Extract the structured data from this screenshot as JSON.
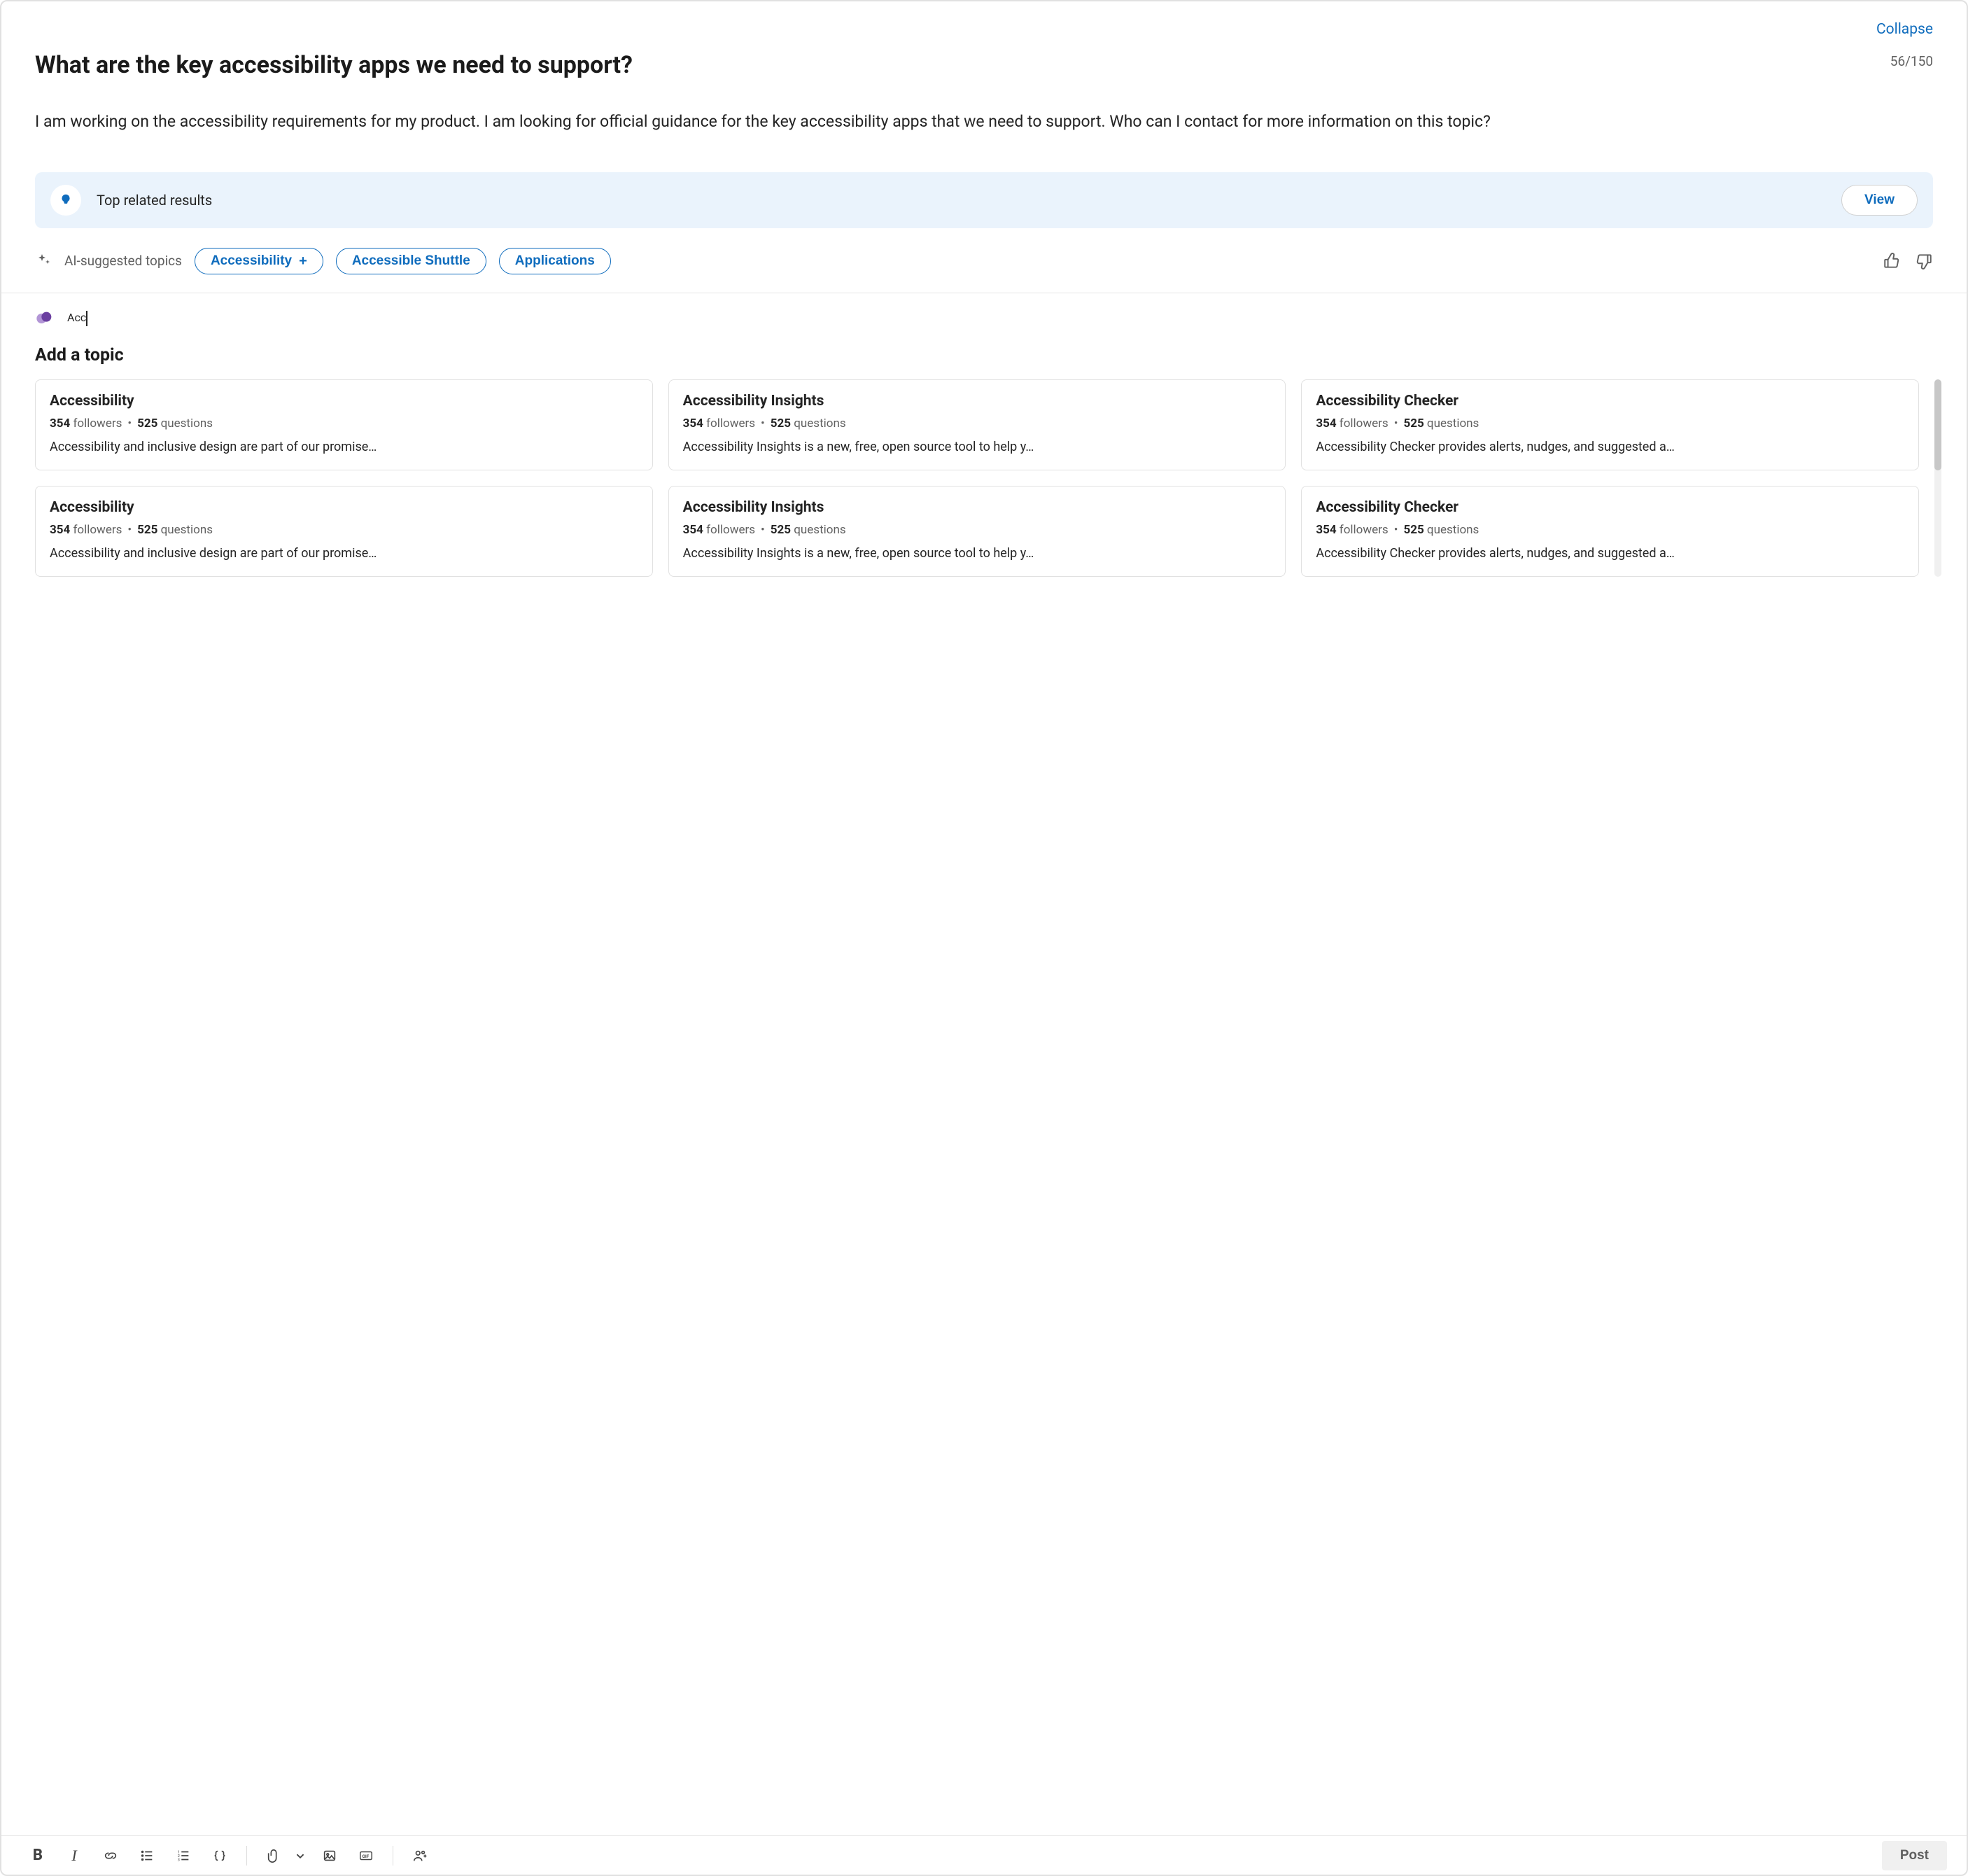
{
  "header": {
    "collapse_label": "Collapse",
    "title": "What are the key accessibility apps we need to support?",
    "char_count": "56/150"
  },
  "body_text": "I am working on the accessibility requirements for my product. I am looking for official guidance for the key accessibility apps that we need to support. Who can I contact for more information on this topic?",
  "related": {
    "label": "Top related results",
    "view_label": "View"
  },
  "ai": {
    "label": "AI-suggested topics",
    "chips": [
      {
        "label": "Accessibility",
        "has_plus": true
      },
      {
        "label": "Accessible Shuttle",
        "has_plus": false
      },
      {
        "label": "Applications",
        "has_plus": false
      }
    ]
  },
  "topic_input": {
    "value": "Acc"
  },
  "add_topic": {
    "heading": "Add a topic",
    "cards": [
      {
        "title": "Accessibility",
        "followers_n": "354",
        "followers_l": "followers",
        "questions_n": "525",
        "questions_l": "questions",
        "desc": "Accessibility and inclusive design are part of our promise…"
      },
      {
        "title": "Accessibility Insights",
        "followers_n": "354",
        "followers_l": "followers",
        "questions_n": "525",
        "questions_l": "questions",
        "desc": "Accessibility Insights is a new, free, open source tool to help y…"
      },
      {
        "title": "Accessibility Checker",
        "followers_n": "354",
        "followers_l": "followers",
        "questions_n": "525",
        "questions_l": "questions",
        "desc": "Accessibility Checker provides alerts, nudges, and suggested a…"
      },
      {
        "title": "Accessibility",
        "followers_n": "354",
        "followers_l": "followers",
        "questions_n": "525",
        "questions_l": "questions",
        "desc": "Accessibility and inclusive design are part of our promise…"
      },
      {
        "title": "Accessibility Insights",
        "followers_n": "354",
        "followers_l": "followers",
        "questions_n": "525",
        "questions_l": "questions",
        "desc": "Accessibility Insights is a new, free, open source tool to help y…"
      },
      {
        "title": "Accessibility Checker",
        "followers_n": "354",
        "followers_l": "followers",
        "questions_n": "525",
        "questions_l": "questions",
        "desc": "Accessibility Checker provides alerts, nudges, and suggested a…"
      }
    ]
  },
  "toolbar": {
    "post_label": "Post"
  }
}
